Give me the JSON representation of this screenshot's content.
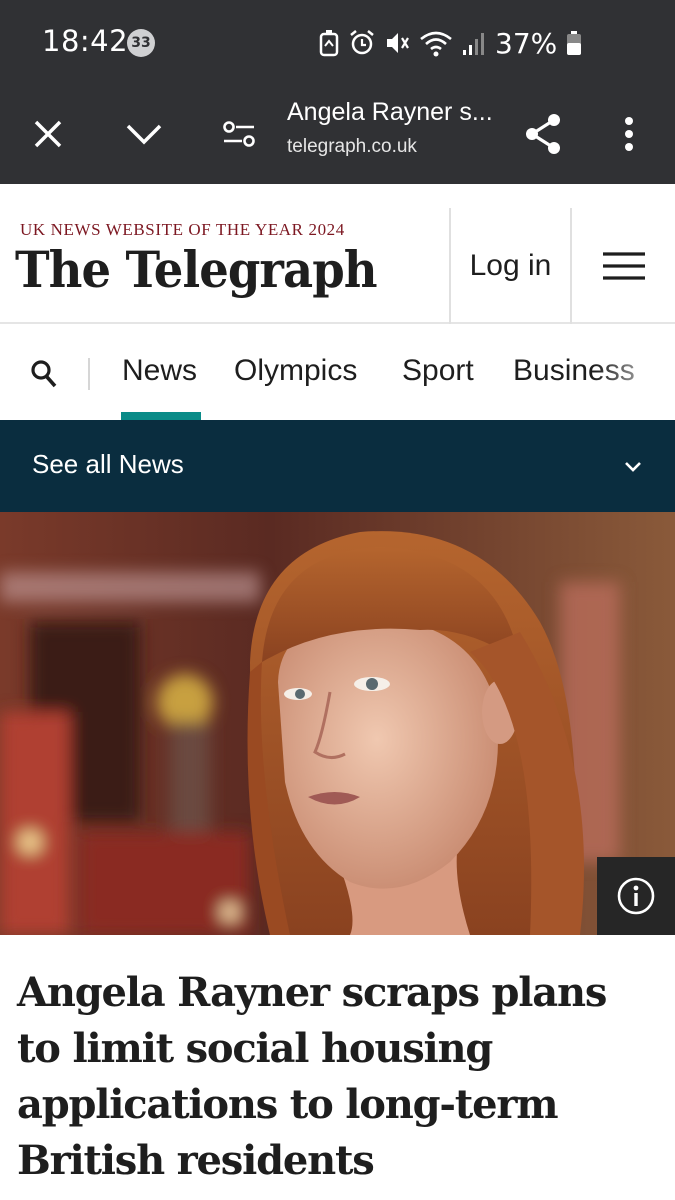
{
  "status_bar": {
    "time": "18:42",
    "notification_count": "33",
    "battery_percent": "37%",
    "icons": [
      "battery-saver-icon",
      "alarm-icon",
      "mute-icon",
      "wifi-icon",
      "signal-icon",
      "battery-icon"
    ]
  },
  "browser": {
    "page_title": "Angela Rayner s...",
    "domain": "telegraph.co.uk",
    "icons": [
      "close-icon",
      "chevron-down-icon",
      "site-settings-icon",
      "share-icon",
      "more-vert-icon"
    ]
  },
  "site_header": {
    "award": "UK NEWS WEBSITE OF THE YEAR 2024",
    "logo_text": "The Telegraph",
    "login_label": "Log in"
  },
  "nav": {
    "items": [
      {
        "label": "News",
        "active": true
      },
      {
        "label": "Olympics",
        "active": false
      },
      {
        "label": "Sport",
        "active": false
      },
      {
        "label": "Business",
        "active": false
      }
    ],
    "accent_color": "#0a8b88"
  },
  "section_bar": {
    "label": "See all News",
    "background": "#0a2d3f"
  },
  "article": {
    "headline": "Angela Rayner scraps plans to limit social housing applications to long-term British residents"
  }
}
